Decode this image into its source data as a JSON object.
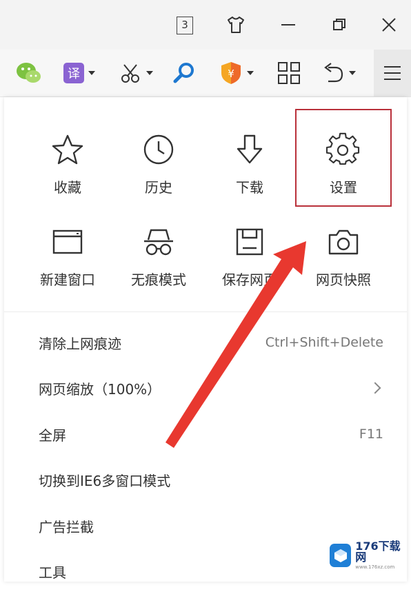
{
  "titlebar": {
    "tab_count": "3",
    "icons": [
      "tab-count-icon",
      "skin-shirt-icon",
      "minimize-icon",
      "restore-icon",
      "close-icon"
    ]
  },
  "toolbar": {
    "icons": [
      "wechat-icon",
      "translate-icon",
      "scissors-icon",
      "search-icon",
      "shield-icon",
      "apps-grid-icon",
      "undo-icon",
      "menu-icon"
    ],
    "translate_glyph": "译",
    "shield_glyph": "¥"
  },
  "panel": {
    "grid": [
      {
        "label": "收藏",
        "icon": "star-icon"
      },
      {
        "label": "历史",
        "icon": "clock-icon"
      },
      {
        "label": "下载",
        "icon": "download-icon"
      },
      {
        "label": "设置",
        "icon": "gear-icon"
      },
      {
        "label": "新建窗口",
        "icon": "new-window-icon"
      },
      {
        "label": "无痕模式",
        "icon": "incognito-icon"
      },
      {
        "label": "保存网页",
        "icon": "save-icon"
      },
      {
        "label": "网页快照",
        "icon": "camera-icon"
      }
    ],
    "menu": [
      {
        "label": "清除上网痕迹",
        "shortcut": "Ctrl+Shift+Delete"
      },
      {
        "label": "网页缩放（100%）",
        "shortcut": ""
      },
      {
        "label": "全屏",
        "shortcut": "F11"
      },
      {
        "label": "切换到IE6多窗口模式",
        "shortcut": ""
      },
      {
        "label": "广告拦截",
        "shortcut": ""
      },
      {
        "label": "工具",
        "shortcut": ""
      }
    ]
  },
  "watermark": {
    "main": "176下载网",
    "sub": "www.176xz.com"
  },
  "colors": {
    "highlight": "#b9303a",
    "arrow": "#e8382f",
    "watermark_blue": "#1f7fd6"
  }
}
